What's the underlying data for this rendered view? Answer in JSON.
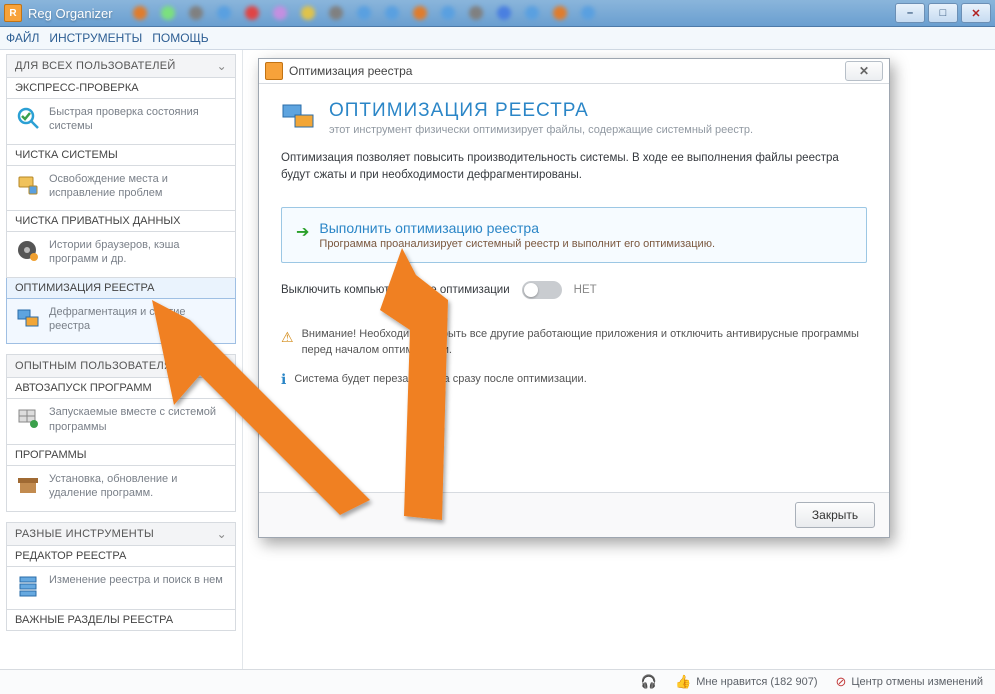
{
  "window": {
    "title": "Reg Organizer",
    "min": "–",
    "max": "□",
    "close": "✕"
  },
  "menu": {
    "file": "ФАЙЛ",
    "tools": "ИНСТРУМЕНТЫ",
    "help": "ПОМОЩЬ"
  },
  "sidebar": {
    "group1": "ДЛЯ ВСЕХ ПОЛЬЗОВАТЕЛЕЙ",
    "items1": [
      {
        "hdr": "ЭКСПРЕСС-ПРОВЕРКА",
        "desc": "Быстрая проверка состояния системы"
      },
      {
        "hdr": "ЧИСТКА СИСТЕМЫ",
        "desc": "Освобождение места и исправление проблем"
      },
      {
        "hdr": "ЧИСТКА ПРИВАТНЫХ ДАННЫХ",
        "desc": "Истории браузеров, кэша программ и др."
      },
      {
        "hdr": "ОПТИМИЗАЦИЯ РЕЕСТРА",
        "desc": "Дефрагментация и сжатие реестра"
      }
    ],
    "group2": "ОПЫТНЫМ ПОЛЬЗОВАТЕЛЯМ",
    "items2": [
      {
        "hdr": "АВТОЗАПУСК ПРОГРАММ",
        "desc": "Запускаемые вместе с системой программы"
      },
      {
        "hdr": "ПРОГРАММЫ",
        "desc": "Установка, обновление и удаление программ."
      }
    ],
    "group3": "РАЗНЫЕ ИНСТРУМЕНТЫ",
    "items3": [
      {
        "hdr": "РЕДАКТОР РЕЕСТРА",
        "desc": "Изменение реестра и поиск в нем"
      },
      {
        "hdr": "ВАЖНЫЕ РАЗДЕЛЫ РЕЕСТРА"
      }
    ]
  },
  "modal": {
    "title": "Оптимизация реестра",
    "sec_title": "ОПТИМИЗАЦИЯ РЕЕСТРА",
    "sec_sub": "этот инструмент физически оптимизирует файлы, содержащие системный реестр.",
    "para": "Оптимизация позволяет повысить производительность системы. В ходе ее выполнения файлы реестра будут сжаты и при необходимости дефрагментированы.",
    "action_title": "Выполнить оптимизацию реестра",
    "action_sub": "Программа проанализирует системный реестр и выполнит его оптимизацию.",
    "toggle_label_left": "Выключить компьютер после оптимизации",
    "toggle_state": "НЕТ",
    "warn": "Внимание! Необходимо закрыть все другие работающие приложения и отключить антивирусные программы перед началом оптимизации.",
    "info": "Система будет перезагружена сразу после оптимизации.",
    "close_btn": "Закрыть"
  },
  "status": {
    "like": "Мне нравится (182 907)",
    "undo": "Центр отмены изменений"
  }
}
